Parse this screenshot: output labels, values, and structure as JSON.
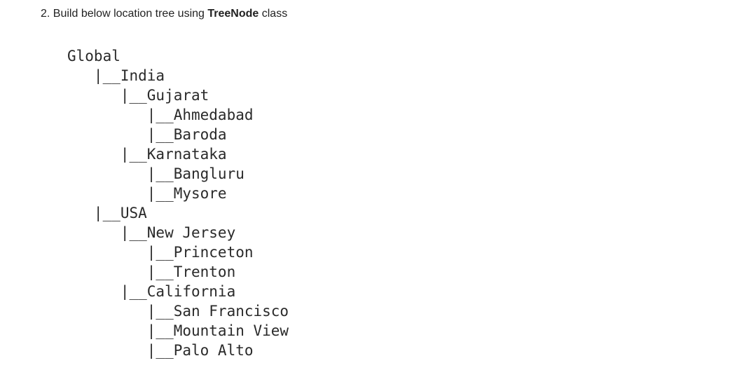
{
  "instruction": {
    "prefix": "2. Build below location tree using ",
    "class_name": "TreeNode",
    "suffix": " class"
  },
  "tree": {
    "lines": [
      "Global",
      "   |__India",
      "      |__Gujarat",
      "         |__Ahmedabad",
      "         |__Baroda",
      "      |__Karnataka",
      "         |__Bangluru",
      "         |__Mysore",
      "   |__USA",
      "      |__New Jersey",
      "         |__Princeton",
      "         |__Trenton",
      "      |__California",
      "         |__San Francisco",
      "         |__Mountain View",
      "         |__Palo Alto"
    ]
  }
}
